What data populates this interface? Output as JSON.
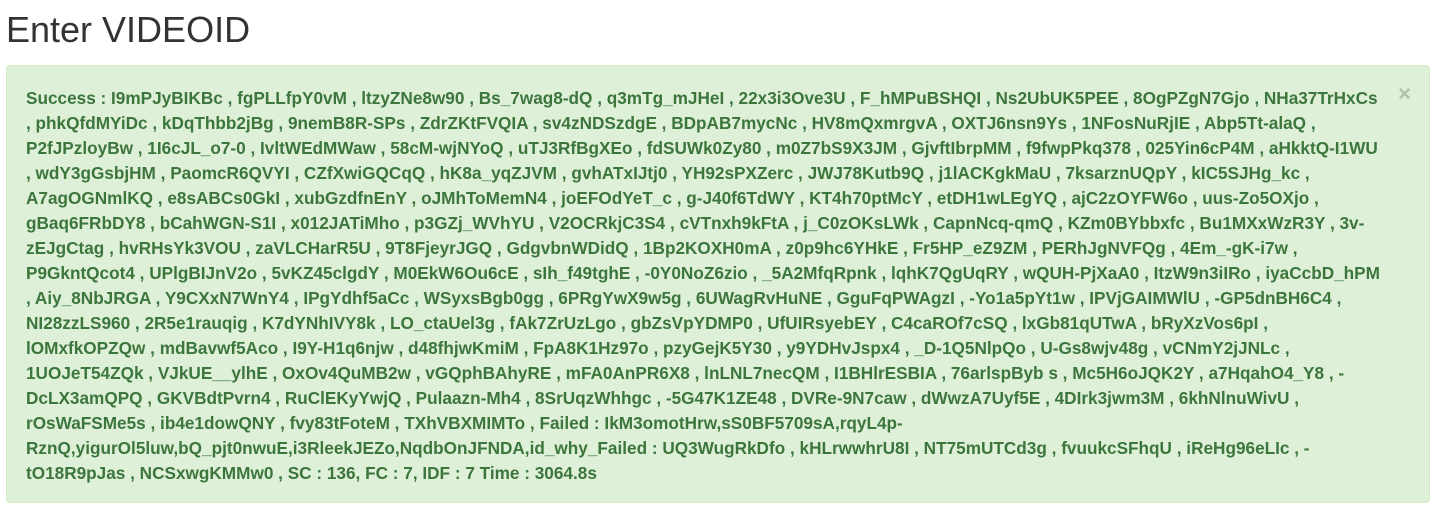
{
  "page": {
    "title": "Enter VIDEOID"
  },
  "alert": {
    "close_icon": "×",
    "message": "Success : I9mPJyBIKBc , fgPLLfpY0vM , ltzyZNe8w90 , Bs_7wag8-dQ , q3mTg_mJHeI , 22x3i3Ove3U , F_hMPuBSHQI , Ns2UbUK5PEE , 8OgPZgN7Gjo , NHa37TrHxCs , phkQfdMYiDc , kDqThbb2jBg , 9nemB8R-SPs , ZdrZKtFVQIA , sv4zNDSzdgE , BDpAB7mycNc , HV8mQxmrgvA , OXTJ6nsn9Ys , 1NFosNuRjIE , Abp5Tt-alaQ , P2fJPzloyBw , 1I6cJL_o7-0 , IvltWEdMWaw , 58cM-wjNYoQ , uTJ3RfBgXEo , fdSUWk0Zy80 , m0Z7bS9X3JM , GjvftIbrpMM , f9fwpPkq378 , 025Yin6cP4M , aHkktQ-I1WU , wdY3gGsbjHM , PaomcR6QVYI , CZfXwiGQCqQ , hK8a_yqZJVM , gvhATxIJtj0 , YH92sPXZerc , JWJ78Kutb9Q , j1lACKgkMaU , 7ksarznUQpY , kIC5SJHg_kc , A7agOGNmlKQ , e8sABCs0GkI , xubGzdfnEnY , oJMhToMemN4 , joEFOdYeT_c , g-J40f6TdWY , KT4h70ptMcY , etDH1wLEgYQ , ajC2zOYFW6o , uus-Zo5OXjo , gBaq6FRbDY8 , bCahWGN-S1I , x012JATiMho , p3GZj_WVhYU , V2OCRkjC3S4 , cVTnxh9kFtA , j_C0zOKsLWk , CapnNcq-qmQ , KZm0BYbbxfc , Bu1MXxWzR3Y , 3v-zEJgCtag , hvRHsYk3VOU , zaVLCHarR5U , 9T8FjeyrJGQ , GdgvbnWDidQ , 1Bp2KOXH0mA , z0p9hc6YHkE , Fr5HP_eZ9ZM , PERhJgNVFQg , 4Em_-gK-i7w , P9GkntQcot4 , UPlgBIJnV2o , 5vKZ45clgdY , M0EkW6Ou6cE , sIh_f49tghE , -0Y0NoZ6zio , _5A2MfqRpnk , lqhK7QgUqRY , wQUH-PjXaA0 , ItzW9n3iIRo , iyaCcbD_hPM , Aiy_8NbJRGA , Y9CXxN7WnY4 , IPgYdhf5aCc , WSyxsBgb0gg , 6PRgYwX9w5g , 6UWagRvHuNE , GguFqPWAgzI , -Yo1a5pYt1w , IPVjGAIMWlU , -GP5dnBH6C4 , NI28zzLS960 , 2R5e1rauqig , K7dYNhIVY8k , LO_ctaUel3g , fAk7ZrUzLgo , gbZsVpYDMP0 , UfUIRsyebEY , C4caROf7cSQ , lxGb81qUTwA , bRyXzVos6pI , lOMxfkOPZQw , mdBavwf5Aco , I9Y-H1q6njw , d48fhjwKmiM , FpA8K1Hz97o , pzyGejK5Y30 , y9YDHvJspx4 , _D-1Q5NlpQo , U-Gs8wjv48g , vCNmY2jJNLc , 1UOJeT54ZQk , VJkUE__ylhE , OxOv4QuMB2w , vGQphBAhyRE , mFA0AnPR6X8 , lnLNL7necQM , I1BHlrESBIA , 76arlspByb s , Mc5H6oJQK2Y , a7HqahO4_Y8 , -DcLX3amQPQ , GKVBdtPvrn4 , RuClEKyYwjQ , Pulaazn-Mh4 , 8SrUqzWhhgc , -5G47K1ZE48 , DVRe-9N7caw , dWwzA7Uyf5E , 4DIrk3jwm3M , 6khNlnuWivU , rOsWaFSMe5s , ib4e1dowQNY , fvy83tFoteM , TXhVBXMIMTo , Failed : IkM3omotHrw,sS0BF5709sA,rqyL4p-RznQ,yigurOl5luw,bQ_pjt0nwuE,i3RleekJEZo,NqdbOnJFNDA,id_why_Failed : UQ3WugRkDfo , kHLrwwhrU8I , NT75mUTCd3g , fvuukcSFhqU , iReHg96eLIc , -tO18R9pJas , NCSxwgKMMw0 , SC : 136, FC : 7, IDF : 7 Time : 3064.8s"
  }
}
